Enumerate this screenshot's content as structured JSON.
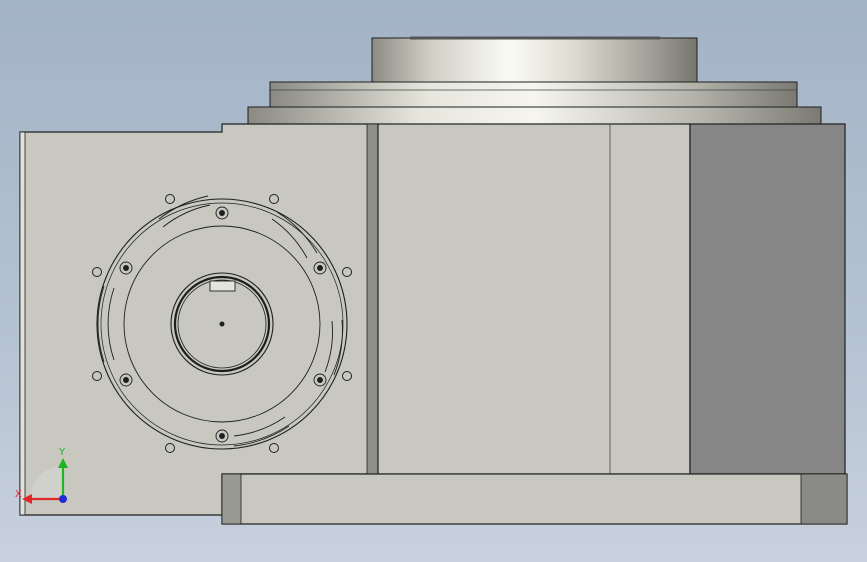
{
  "viewport": {
    "background_top": "#a3b3c6",
    "background_bottom": "#c8d1de"
  },
  "colors": {
    "body_face": "#c8c8c0",
    "side_face": "#868686",
    "edge": "#1e1e1e",
    "x_axis": "#e3262a",
    "y_axis": "#1fb51f",
    "z_axis": "#1f2bd6"
  },
  "triad": {
    "x_label": "X",
    "y_label": "Y"
  },
  "icons": [
    "coordinate-triad-icon"
  ]
}
